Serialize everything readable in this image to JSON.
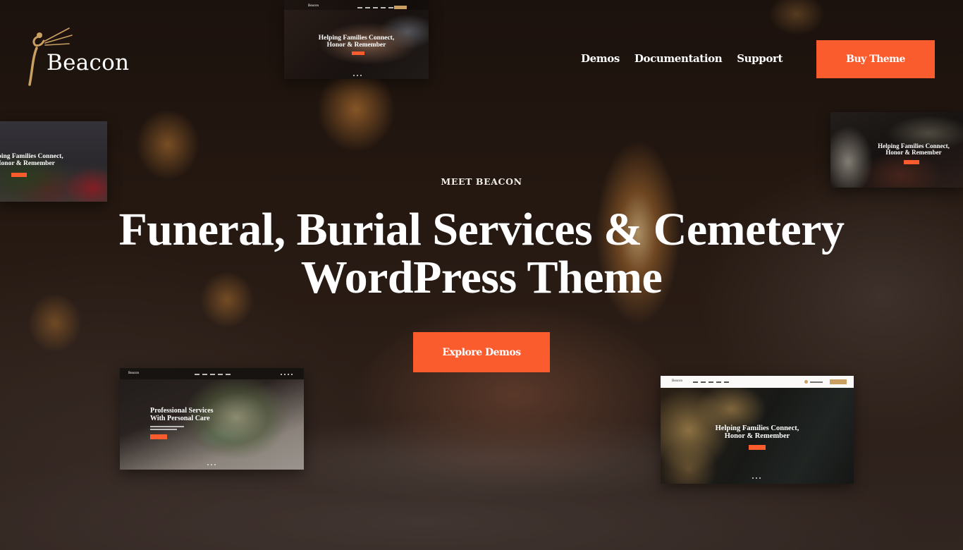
{
  "brand": {
    "name": "Beacon",
    "logo_icon": "beacon-figure-icon",
    "accent_color": "#fa5c2e",
    "logo_gold": "#c9a062"
  },
  "nav": {
    "items": [
      {
        "label": "Demos"
      },
      {
        "label": "Documentation"
      },
      {
        "label": "Support"
      }
    ],
    "cta_label": "Buy Theme"
  },
  "hero": {
    "eyebrow": "MEET BEACON",
    "headline_line1": "Funeral, Burial Services & Cemetery",
    "headline_line2": "WordPress Theme",
    "cta_label": "Explore Demos"
  },
  "demo_previews": [
    {
      "position": "top-center",
      "headline_line1": "Helping Families Connect,",
      "headline_line2": "Honor & Remember"
    },
    {
      "position": "left",
      "headline_line1": "Helping Families Connect,",
      "headline_line2": "Honor & Remember"
    },
    {
      "position": "right",
      "headline_line1": "Helping Families Connect,",
      "headline_line2": "Honor & Remember"
    },
    {
      "position": "bottom-left",
      "headline_line1": "Professional Services",
      "headline_line2": "With Personal Care",
      "logo": "Beacon"
    },
    {
      "position": "bottom-right",
      "headline_line1": "Helping Families Connect,",
      "headline_line2": "Honor & Remember",
      "logo": "Beacon"
    }
  ]
}
